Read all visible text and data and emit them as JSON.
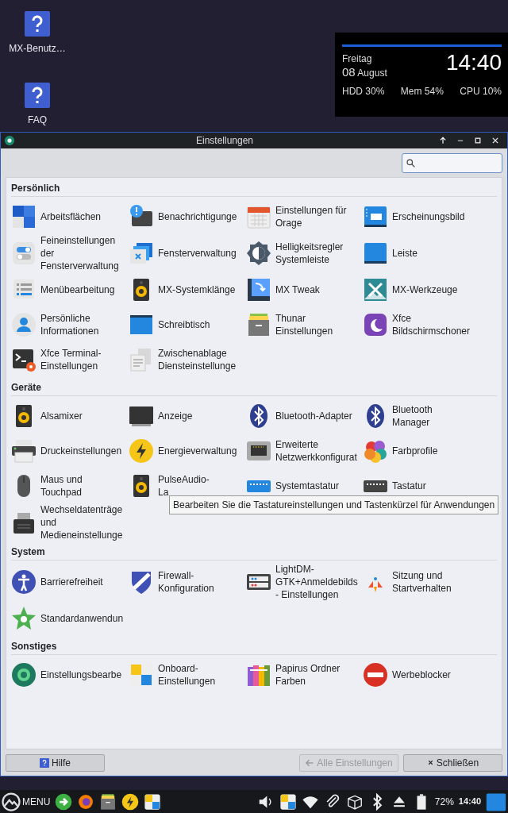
{
  "desktop_icons": [
    {
      "label": "MX-Benutz…"
    },
    {
      "label": "FAQ"
    }
  ],
  "conky": {
    "day": "Freitag",
    "date": "08",
    "month": "August",
    "time": "14:40",
    "stats": [
      {
        "label": "HDD",
        "value": "30%"
      },
      {
        "label": "Mem",
        "value": "54%"
      },
      {
        "label": "CPU",
        "value": "10%"
      }
    ]
  },
  "window": {
    "title": "Einstellungen"
  },
  "sections": [
    {
      "title": "Persönlich",
      "items": [
        {
          "label": "Arbeitsflächen"
        },
        {
          "label": "Benachrichtigunge"
        },
        {
          "label": "Einstellungen für\nOrage"
        },
        {
          "label": "Erscheinungsbild"
        },
        {
          "label": "Feineinstellungen\nder\nFensterverwaltung"
        },
        {
          "label": "Fensterverwaltung"
        },
        {
          "label": "Helligkeitsregler\nSystemleiste"
        },
        {
          "label": "Leiste"
        },
        {
          "label": "Menübearbeitung"
        },
        {
          "label": "MX-Systemklänge"
        },
        {
          "label": "MX Tweak"
        },
        {
          "label": "MX-Werkzeuge"
        },
        {
          "label": "Persönliche\nInformationen"
        },
        {
          "label": "Schreibtisch"
        },
        {
          "label": "Thunar\nEinstellungen"
        },
        {
          "label": "Xfce\nBildschirmschoner"
        },
        {
          "label": "Xfce Terminal-\nEinstellungen"
        },
        {
          "label": "Zwischenablage\nDiensteinstellunge"
        }
      ]
    },
    {
      "title": "Geräte",
      "items": [
        {
          "label": "Alsamixer"
        },
        {
          "label": "Anzeige"
        },
        {
          "label": "Bluetooth-Adapter"
        },
        {
          "label": "Bluetooth\nManager"
        },
        {
          "label": "Druckeinstellungen"
        },
        {
          "label": "Energieverwaltung"
        },
        {
          "label": "Erweiterte\nNetzwerkkonfigurat"
        },
        {
          "label": "Farbprofile"
        },
        {
          "label": "Maus und\nTouchpad"
        },
        {
          "label": "PulseAudio-\nLa"
        },
        {
          "label": "Systemtastatur"
        },
        {
          "label": "Tastatur"
        },
        {
          "label": "Wechseldatenträge\nund\nMedieneinstellunge"
        }
      ]
    },
    {
      "title": "System",
      "items": [
        {
          "label": "Barrierefreiheit"
        },
        {
          "label": "Firewall-\nKonfiguration"
        },
        {
          "label": "LightDM-\nGTK+Anmeldebilds\n- Einstellungen"
        },
        {
          "label": "Sitzung und\nStartverhalten"
        },
        {
          "label": "Standardanwendun"
        }
      ]
    },
    {
      "title": "Sonstiges",
      "items": [
        {
          "label": "Einstellungsbearbe"
        },
        {
          "label": "Onboard-\nEinstellungen"
        },
        {
          "label": "Papirus Ordner\nFarben"
        },
        {
          "label": "Werbeblocker"
        }
      ]
    }
  ],
  "tooltip": "Bearbeiten Sie die Tastatureinstellungen und Tastenkürzel für Anwendungen",
  "buttons": [
    {
      "label": "Hilfe",
      "disabled": false
    },
    {
      "label": "Alle Einstellungen",
      "disabled": true
    },
    {
      "label": "Schließen",
      "disabled": false
    }
  ],
  "taskbar": {
    "menu_label": "MENU",
    "battery": "72%",
    "clock": "14:40"
  }
}
